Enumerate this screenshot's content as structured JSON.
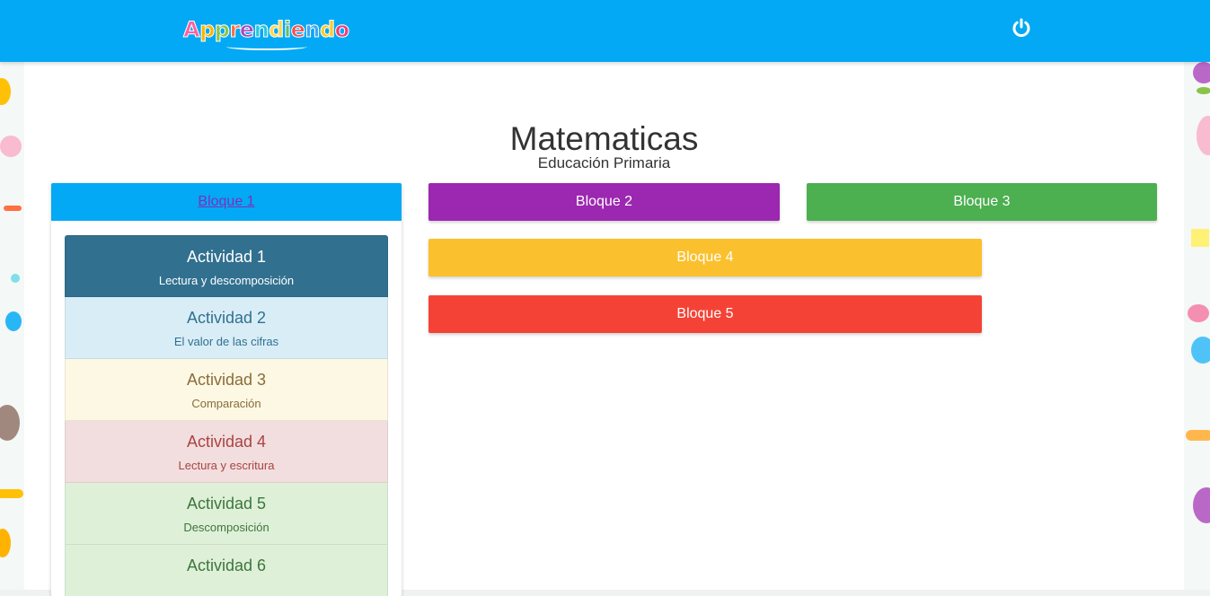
{
  "header": {
    "logo_text": "Apprendiendo",
    "logo_letters": [
      {
        "ch": "A",
        "color": "#ff5fa2"
      },
      {
        "ch": "p",
        "color": "#ffb300"
      },
      {
        "ch": "p",
        "color": "#8bc34a"
      },
      {
        "ch": "r",
        "color": "#ff7043"
      },
      {
        "ch": "e",
        "color": "#ab47bc"
      },
      {
        "ch": "n",
        "color": "#26c6da"
      },
      {
        "ch": "d",
        "color": "#ffd54f"
      },
      {
        "ch": "i",
        "color": "#66bb6a"
      },
      {
        "ch": "e",
        "color": "#ef5350"
      },
      {
        "ch": "n",
        "color": "#42a5f5"
      },
      {
        "ch": "d",
        "color": "#ffca28"
      },
      {
        "ch": "o",
        "color": "#ec407a"
      }
    ],
    "power_icon": "power-icon",
    "color": "#03a9f4"
  },
  "page": {
    "title": "Matematicas",
    "subtitle": "Educación Primaria"
  },
  "bloques": [
    {
      "label": "Bloque 1",
      "color": "#03a9f4",
      "active": true
    },
    {
      "label": "Bloque 2",
      "color": "#9c27b0"
    },
    {
      "label": "Bloque 3",
      "color": "#4caf50"
    },
    {
      "label": "Bloque 4",
      "color": "#fbc02d"
    },
    {
      "label": "Bloque 5",
      "color": "#f44336"
    }
  ],
  "actividades": [
    {
      "title": "Actividad 1",
      "subtitle": "Lectura y descomposición",
      "bg": "#31708f",
      "fg": "#ffffff"
    },
    {
      "title": "Actividad 2",
      "subtitle": "El valor de las cifras",
      "bg": "#d9edf7",
      "fg": "#31708f"
    },
    {
      "title": "Actividad 3",
      "subtitle": "Comparación",
      "bg": "#fcf8e3",
      "fg": "#8a6d3b"
    },
    {
      "title": "Actividad 4",
      "subtitle": "Lectura y escritura",
      "bg": "#f2dede",
      "fg": "#a94442"
    },
    {
      "title": "Actividad 5",
      "subtitle": "Descomposición",
      "bg": "#dff0d8",
      "fg": "#3c763d"
    },
    {
      "title": "Actividad 6",
      "subtitle": "",
      "bg": "#dff0d8",
      "fg": "#3c763d"
    }
  ]
}
